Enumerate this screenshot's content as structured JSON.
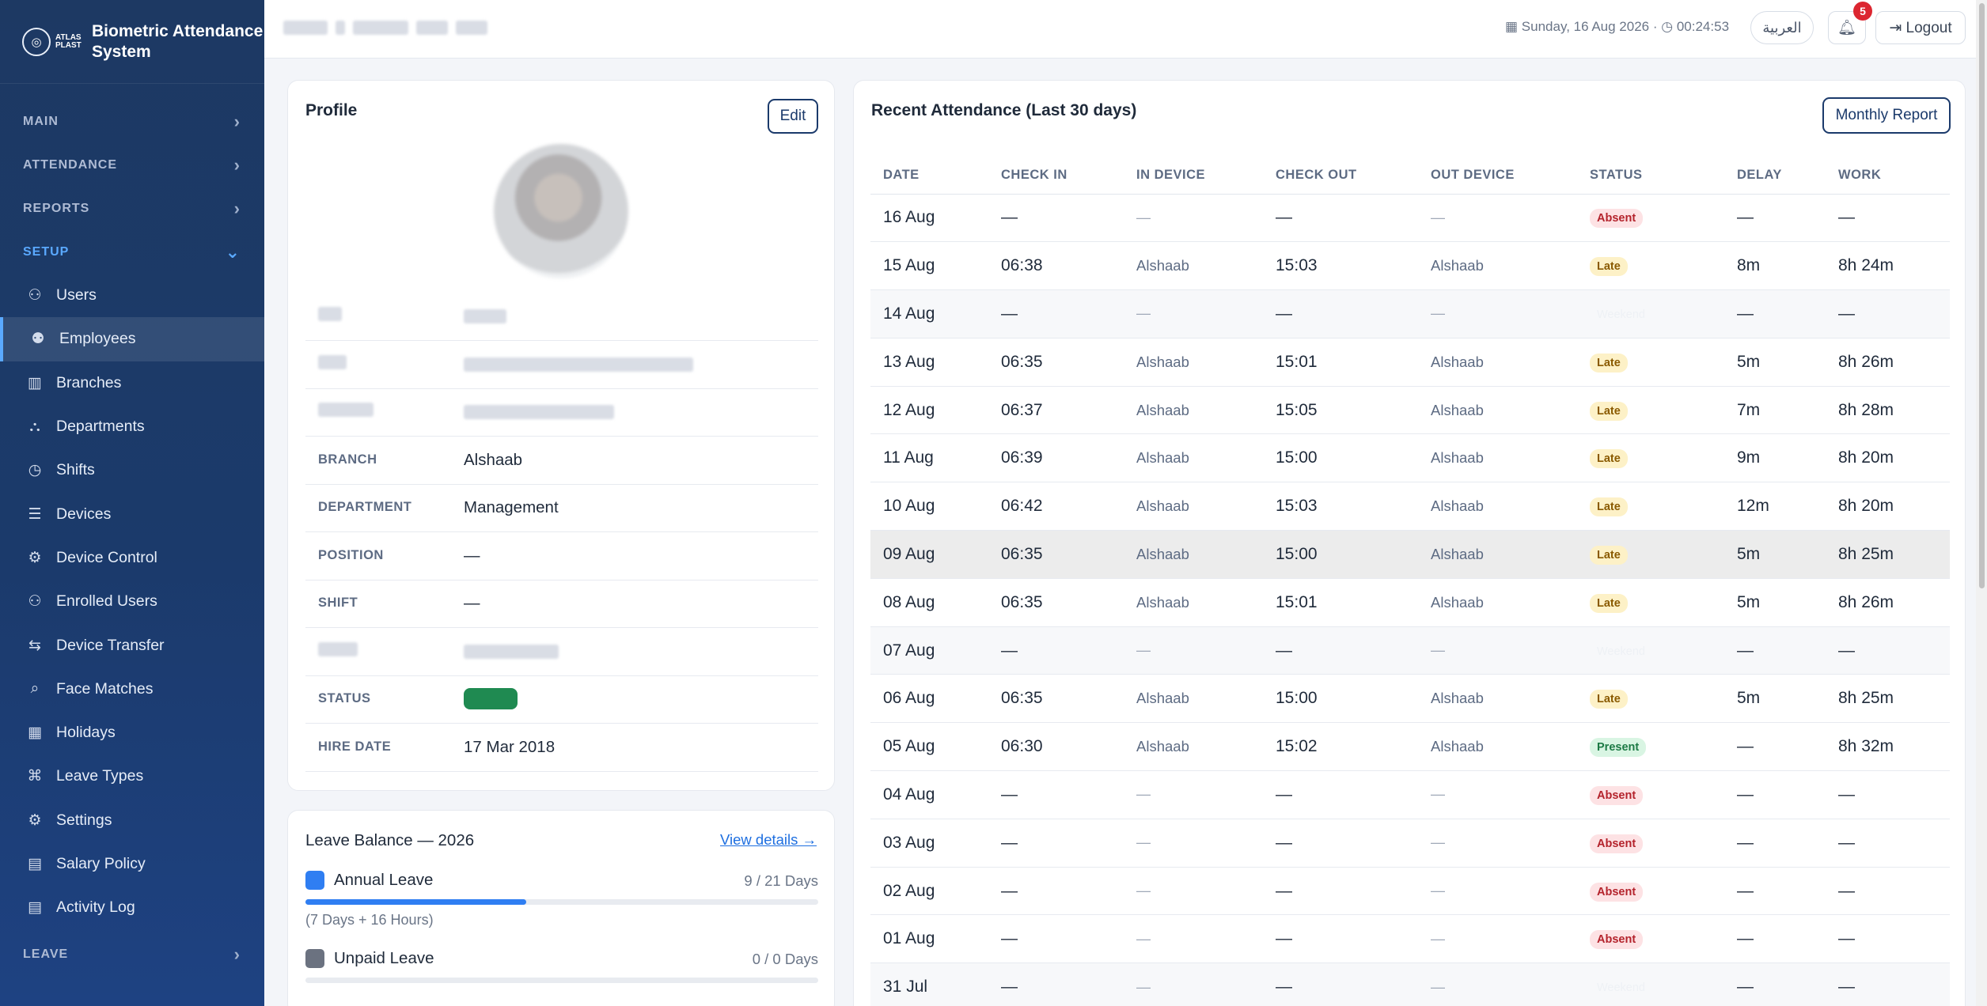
{
  "brand": {
    "logo_text": "ATLAS PLAST",
    "title_line1": "Biometric Attendance",
    "title_line2": "System"
  },
  "sidebar": {
    "sections": {
      "main": "MAIN",
      "attendance": "ATTENDANCE",
      "reports": "REPORTS",
      "setup": "SETUP",
      "leave": "LEAVE"
    },
    "items": [
      {
        "label": "Users",
        "icon": "user-icon"
      },
      {
        "label": "Employees",
        "icon": "users-icon"
      },
      {
        "label": "Branches",
        "icon": "building-icon"
      },
      {
        "label": "Departments",
        "icon": "sitemap-icon"
      },
      {
        "label": "Shifts",
        "icon": "clock-icon"
      },
      {
        "label": "Devices",
        "icon": "sliders-icon"
      },
      {
        "label": "Device Control",
        "icon": "device-control-icon"
      },
      {
        "label": "Enrolled Users",
        "icon": "user-check-icon"
      },
      {
        "label": "Device Transfer",
        "icon": "transfer-icon"
      },
      {
        "label": "Face Matches",
        "icon": "face-search-icon"
      },
      {
        "label": "Holidays",
        "icon": "calendar-icon"
      },
      {
        "label": "Leave Types",
        "icon": "tag-icon"
      },
      {
        "label": "Settings",
        "icon": "gear-icon"
      },
      {
        "label": "Salary Policy",
        "icon": "document-icon"
      },
      {
        "label": "Activity Log",
        "icon": "log-icon"
      }
    ]
  },
  "topbar": {
    "date": "Sunday, 16 Aug 2026",
    "separator": "·",
    "time": "00:24:53",
    "language_button": "العربية",
    "notification_count": "5",
    "logout_label": "Logout"
  },
  "profile": {
    "title": "Profile",
    "edit_label": "Edit",
    "fields": {
      "branch_label": "BRANCH",
      "branch_value": "Alshaab",
      "department_label": "DEPARTMENT",
      "department_value": "Management",
      "position_label": "POSITION",
      "position_value": "—",
      "shift_label": "SHIFT",
      "shift_value": "—",
      "status_label": "STATUS",
      "hire_date_label": "HIRE DATE",
      "hire_date_value": "17 Mar 2018"
    }
  },
  "leave_balance": {
    "title": "Leave Balance — 2026",
    "view_details": "View details →",
    "items": [
      {
        "name": "Annual Leave",
        "count": "9 / 21 Days",
        "used_fraction": 0.43,
        "note": "(7 Days + 16 Hours)",
        "color": "#2f7ef2"
      },
      {
        "name": "Unpaid Leave",
        "count": "0 / 0 Days",
        "used_fraction": 0,
        "color": "#6b7280"
      }
    ]
  },
  "attendance": {
    "title": "Recent Attendance (Last 30 days)",
    "report_button": "Monthly Report",
    "columns": [
      "DATE",
      "CHECK IN",
      "IN DEVICE",
      "CHECK OUT",
      "OUT DEVICE",
      "STATUS",
      "DELAY",
      "WORK"
    ],
    "rows": [
      {
        "date": "16 Aug",
        "in": "—",
        "in_dev": "—",
        "out": "—",
        "out_dev": "—",
        "status": "Absent",
        "kind": "absent",
        "delay": "—",
        "work": "—"
      },
      {
        "date": "15 Aug",
        "in": "06:38",
        "in_dev": "Alshaab",
        "out": "15:03",
        "out_dev": "Alshaab",
        "status": "Late",
        "kind": "late",
        "delay": "8m",
        "work": "8h 24m"
      },
      {
        "date": "14 Aug",
        "in": "—",
        "in_dev": "—",
        "out": "—",
        "out_dev": "—",
        "status": "Weekend",
        "kind": "weekend",
        "delay": "—",
        "work": "—"
      },
      {
        "date": "13 Aug",
        "in": "06:35",
        "in_dev": "Alshaab",
        "out": "15:01",
        "out_dev": "Alshaab",
        "status": "Late",
        "kind": "late",
        "delay": "5m",
        "work": "8h 26m"
      },
      {
        "date": "12 Aug",
        "in": "06:37",
        "in_dev": "Alshaab",
        "out": "15:05",
        "out_dev": "Alshaab",
        "status": "Late",
        "kind": "late",
        "delay": "7m",
        "work": "8h 28m"
      },
      {
        "date": "11 Aug",
        "in": "06:39",
        "in_dev": "Alshaab",
        "out": "15:00",
        "out_dev": "Alshaab",
        "status": "Late",
        "kind": "late",
        "delay": "9m",
        "work": "8h 20m"
      },
      {
        "date": "10 Aug",
        "in": "06:42",
        "in_dev": "Alshaab",
        "out": "15:03",
        "out_dev": "Alshaab",
        "status": "Late",
        "kind": "late",
        "delay": "12m",
        "work": "8h 20m"
      },
      {
        "date": "09 Aug",
        "in": "06:35",
        "in_dev": "Alshaab",
        "out": "15:00",
        "out_dev": "Alshaab",
        "status": "Late",
        "kind": "late",
        "delay": "5m",
        "work": "8h 25m",
        "hover": true
      },
      {
        "date": "08 Aug",
        "in": "06:35",
        "in_dev": "Alshaab",
        "out": "15:01",
        "out_dev": "Alshaab",
        "status": "Late",
        "kind": "late",
        "delay": "5m",
        "work": "8h 26m"
      },
      {
        "date": "07 Aug",
        "in": "—",
        "in_dev": "—",
        "out": "—",
        "out_dev": "—",
        "status": "Weekend",
        "kind": "weekend",
        "delay": "—",
        "work": "—"
      },
      {
        "date": "06 Aug",
        "in": "06:35",
        "in_dev": "Alshaab",
        "out": "15:00",
        "out_dev": "Alshaab",
        "status": "Late",
        "kind": "late",
        "delay": "5m",
        "work": "8h 25m"
      },
      {
        "date": "05 Aug",
        "in": "06:30",
        "in_dev": "Alshaab",
        "out": "15:02",
        "out_dev": "Alshaab",
        "status": "Present",
        "kind": "present",
        "delay": "—",
        "work": "8h 32m"
      },
      {
        "date": "04 Aug",
        "in": "—",
        "in_dev": "—",
        "out": "—",
        "out_dev": "—",
        "status": "Absent",
        "kind": "absent",
        "delay": "—",
        "work": "—"
      },
      {
        "date": "03 Aug",
        "in": "—",
        "in_dev": "—",
        "out": "—",
        "out_dev": "—",
        "status": "Absent",
        "kind": "absent",
        "delay": "—",
        "work": "—"
      },
      {
        "date": "02 Aug",
        "in": "—",
        "in_dev": "—",
        "out": "—",
        "out_dev": "—",
        "status": "Absent",
        "kind": "absent",
        "delay": "—",
        "work": "—"
      },
      {
        "date": "01 Aug",
        "in": "—",
        "in_dev": "—",
        "out": "—",
        "out_dev": "—",
        "status": "Absent",
        "kind": "absent",
        "delay": "—",
        "work": "—"
      },
      {
        "date": "31 Jul",
        "in": "—",
        "in_dev": "—",
        "out": "—",
        "out_dev": "—",
        "status": "Weekend",
        "kind": "weekend",
        "delay": "—",
        "work": "—"
      }
    ]
  }
}
